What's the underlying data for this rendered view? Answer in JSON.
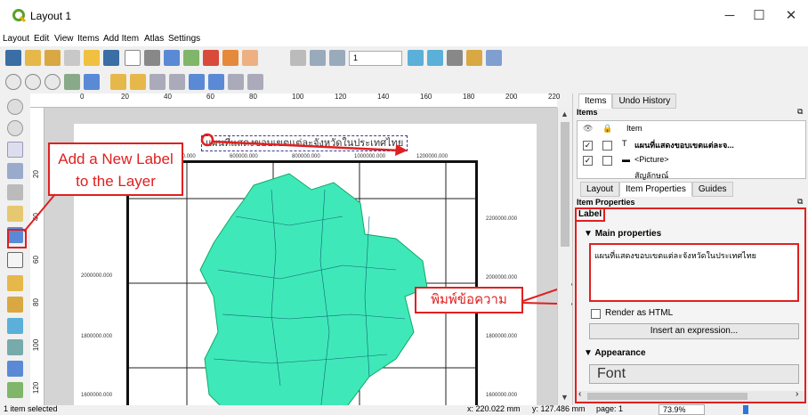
{
  "window": {
    "title": "Layout 1",
    "minimize": "─",
    "maximize": "☐",
    "close": "✕"
  },
  "menu": [
    "Layout",
    "Edit",
    "View",
    "Items",
    "Add Item",
    "Atlas",
    "Settings"
  ],
  "toolbar": {
    "page_field": "1"
  },
  "ruler": {
    "top_ticks": [
      "0",
      "20",
      "40",
      "60",
      "80",
      "100",
      "120",
      "140",
      "160",
      "180",
      "200",
      "220"
    ],
    "left_ticks": [
      "20",
      "40",
      "60",
      "80",
      "100",
      "120"
    ]
  },
  "map": {
    "title_label": "แผนที่แสดงขอบเขตแต่ละจังหวัดในประเทศไทย",
    "x_ticks": [
      "400000.000",
      "600000.000",
      "800000.000",
      "1000000.000",
      "1200000.000"
    ],
    "y_ticks_left": [
      "2000000.000",
      "1800000.000",
      "1600000.000"
    ],
    "y_ticks_right": [
      "2200000.000",
      "2000000.000",
      "1800000.000",
      "1600000.000"
    ]
  },
  "annotations": {
    "add_label": "Add a New Label to the Layer",
    "type_text": "พิมพ์ข้อความ"
  },
  "panel": {
    "top_tabs": [
      "Items",
      "Undo History"
    ],
    "items_title": "Items",
    "items_header": "Item",
    "items": [
      "แผนที่แสดงขอบเขตแต่ละจ...",
      "<Picture>",
      "สัญลักษณ์"
    ],
    "bottom_tabs": [
      "Layout",
      "Item Properties",
      "Guides"
    ],
    "item_props_title": "Item Properties",
    "label_header": "Label",
    "main_props": "Main properties",
    "label_text": "แผนที่แสดงขอบเขตแต่ละจังหวัดในประเทศไทย",
    "render_html": "Render as HTML",
    "insert_expr": "Insert an expression...",
    "appearance": "Appearance",
    "font": "Font"
  },
  "status": {
    "selected": "1 item selected",
    "x": "x: 220.022 mm",
    "y": "y: 127.486 mm",
    "page": "page: 1",
    "zoom": "73.9%"
  },
  "colors": {
    "accent_red": "#e02020",
    "map_fill": "#3fe8b8",
    "qgis_green": "#5aa02c"
  }
}
